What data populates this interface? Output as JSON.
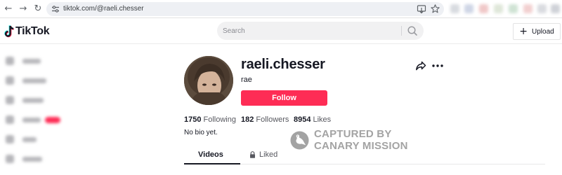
{
  "browser": {
    "url": "tiktok.com/@raeli.chesser",
    "extension_colors": [
      "#d8dbe0",
      "#cfd6e6",
      "#f0c8c8",
      "#dfe7d9",
      "#cfe3d4",
      "#f2d0d0",
      "#d9dbe0",
      "#cfd2d8"
    ]
  },
  "header": {
    "logo_text": "TikTok",
    "search_placeholder": "Search",
    "upload_label": "Upload"
  },
  "profile": {
    "username": "raeli.chesser",
    "nickname": "rae",
    "follow_label": "Follow",
    "stats": [
      {
        "value": "1750",
        "label": "Following"
      },
      {
        "value": "182",
        "label": "Followers"
      },
      {
        "value": "8954",
        "label": "Likes"
      }
    ],
    "bio": "No bio yet."
  },
  "tabs": [
    {
      "label": "Videos",
      "active": true
    },
    {
      "label": "Liked",
      "active": false,
      "locked": true
    }
  ],
  "watermark": {
    "line1": "CAPTURED BY",
    "line2": "CANARY MISSION"
  },
  "colors": {
    "accent": "#fe2c55",
    "text": "#161823",
    "secondary_text": "#57585f"
  }
}
